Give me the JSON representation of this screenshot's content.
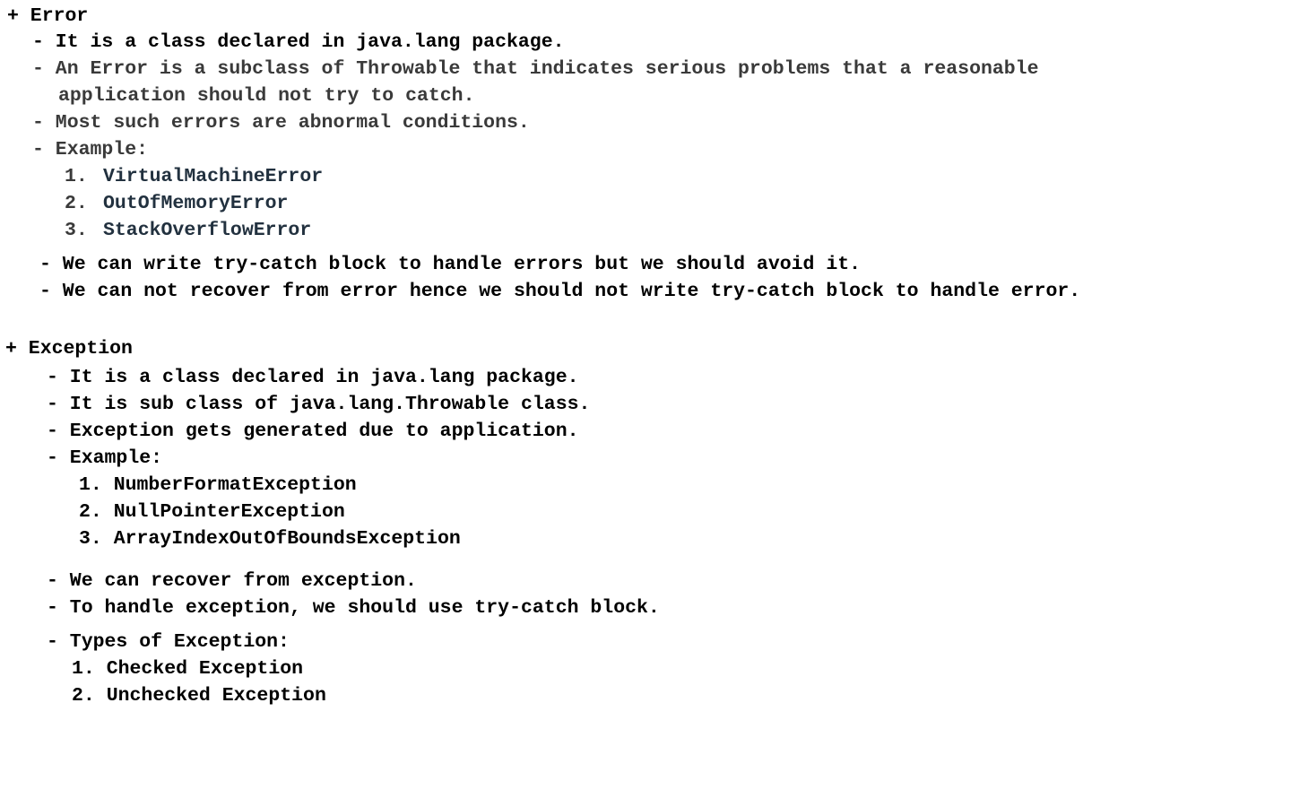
{
  "error_section": {
    "heading": "+ Error",
    "bullets": [
      "- It is a class declared in java.lang package.",
      "- An Error is a subclass of Throwable that indicates serious problems that a reasonable",
      "application should not try to catch.",
      "- Most such errors are abnormal conditions.",
      "- Example:"
    ],
    "examples": [
      "1.",
      "VirtualMachineError",
      "2.",
      "OutOfMemoryError",
      "3.",
      "StackOverflowError"
    ],
    "notes": [
      "- We can write try-catch block to handle errors but we should avoid it.",
      "- We can not recover from error hence we should not write try-catch block to handle error."
    ]
  },
  "exception_section": {
    "heading": "+ Exception",
    "bullets": [
      "- It is a class declared in java.lang package.",
      "- It is sub class of java.lang.Throwable class.",
      "- Exception gets generated due to application.",
      "- Example:"
    ],
    "examples": [
      "1. NumberFormatException",
      "2. NullPointerException",
      "3. ArrayIndexOutOfBoundsException"
    ],
    "notes": [
      "- We can recover from exception.",
      "- To handle exception, we should use try-catch block."
    ],
    "types_heading": "- Types of Exception:",
    "types": [
      "1. Checked Exception",
      "2. Unchecked Exception"
    ]
  }
}
